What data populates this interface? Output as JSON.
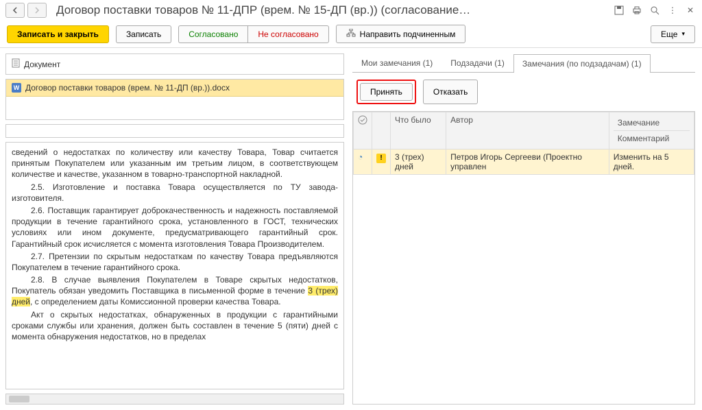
{
  "title": "Договор поставки товаров  № 11-ДПР (врем. № 15-ДП (вр.)) (согласование…",
  "toolbar": {
    "save_close": "Записать и закрыть",
    "save": "Записать",
    "agreed": "Согласовано",
    "not_agreed": "Не согласовано",
    "forward": "Направить подчиненным",
    "more": "Еще"
  },
  "doc_section": {
    "header": "Документ",
    "file": "Договор поставки товаров (врем. № 11-ДП (вр.)).docx"
  },
  "doc_text": {
    "p1": "сведений о недостатках по количеству или качеству Товара, Товар считается принятым Покупателем или указанным им третьим лицом, в соответствующем количестве и качестве, указанном в товарно-транспортной накладной.",
    "p2": "2.5. Изготовление и поставка Товара осуществляется по ТУ завода-изготовителя.",
    "p3": "2.6. Поставщик гарантирует доброкачественность и надежность поставляемой продукции в течение гарантийного срока, установленного в ГОСТ, технических условиях или ином документе, предусматривающего гарантийный срок. Гарантийный срок исчисляется с момента изготовления Товара Производителем.",
    "p4": "2.7. Претензии по скрытым недостаткам по качеству Товара предъявляются Покупателем в течение гарантийного срока.",
    "p5a": "2.8. В случае выявления Покупателем в Товаре скрытых недостатков, Покупатель обязан уведомить Поставщика в письменной форме в течение ",
    "p5h": "3 (трех) дней",
    "p5b": ", с определением даты Комиссионной проверки качества Товара.",
    "p6": "Акт о скрытых недостатках, обнаруженных в продукции с гарантийными сроками службы или хранения, должен быть составлен в течение 5 (пяти) дней с момента обнаружения недостатков, но в пределах"
  },
  "tabs": {
    "my_notes": "Мои замечания (1)",
    "subtasks": "Подзадачи (1)",
    "notes_sub": "Замечания (по подзадачам) (1)"
  },
  "actions": {
    "accept": "Принять",
    "reject": "Отказать"
  },
  "grid": {
    "col_what": "Что было",
    "col_author": "Автор",
    "col_note": "Замечание",
    "col_comment": "Комментарий",
    "row1": {
      "what": "3 (трех) дней",
      "author": "Петров Игорь Сергееви (Проектно управлен",
      "note": "Изменить на 5 дней."
    }
  }
}
